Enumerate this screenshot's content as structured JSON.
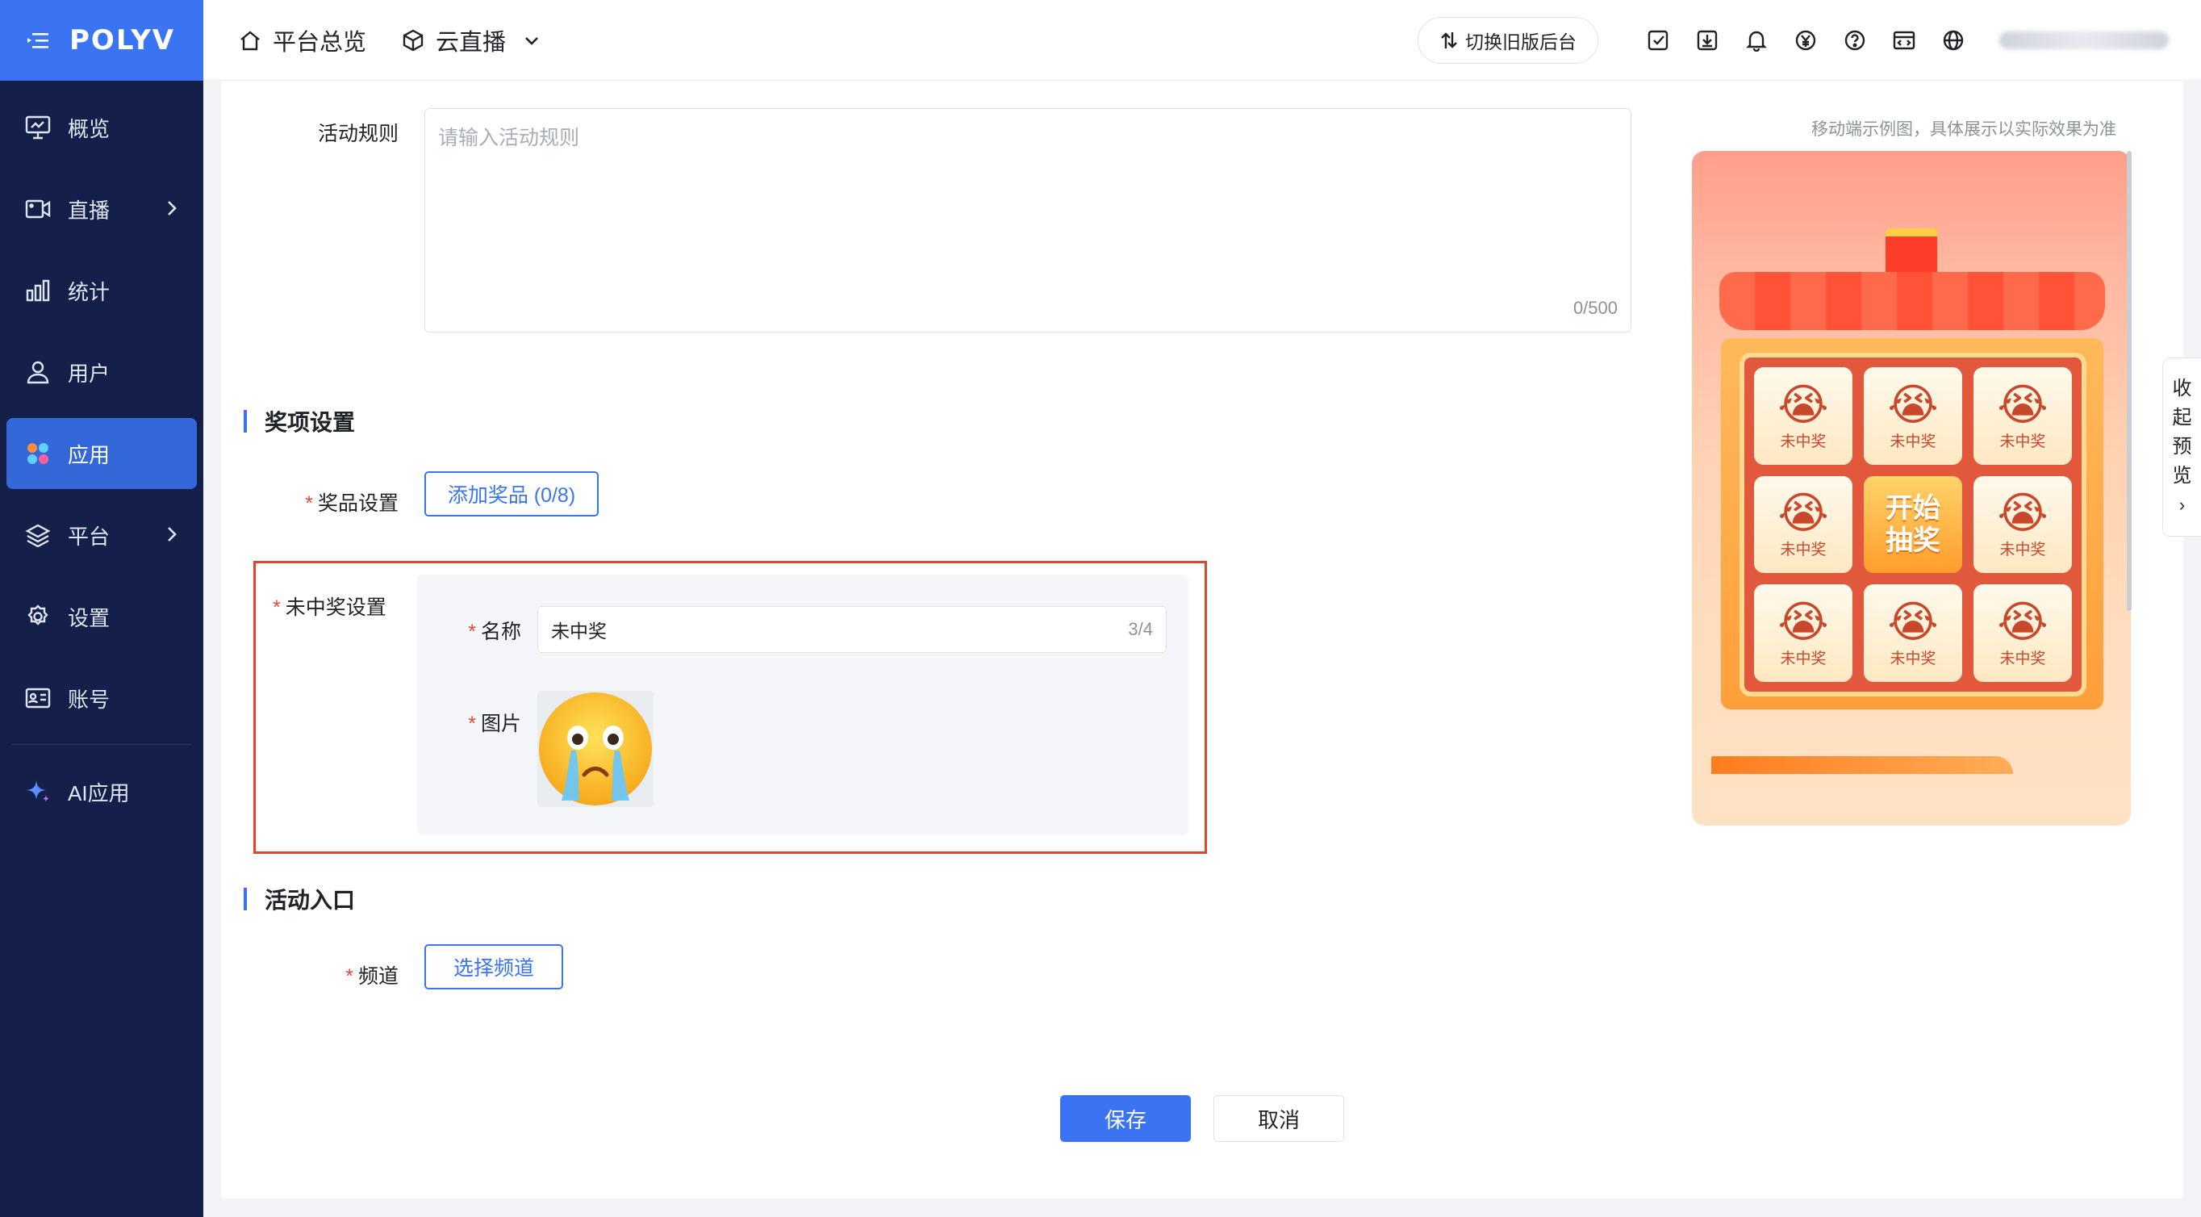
{
  "brand": {
    "logo": "POLYV"
  },
  "sidebar": {
    "items": [
      {
        "label": "概览",
        "icon": "monitor-icon"
      },
      {
        "label": "直播",
        "icon": "video-icon"
      },
      {
        "label": "统计",
        "icon": "bar-chart-icon"
      },
      {
        "label": "用户",
        "icon": "user-icon"
      },
      {
        "label": "应用",
        "icon": "apps-icon"
      },
      {
        "label": "平台",
        "icon": "layers-icon"
      },
      {
        "label": "设置",
        "icon": "gear-icon"
      },
      {
        "label": "账号",
        "icon": "id-card-icon"
      },
      {
        "label": "AI应用",
        "icon": "sparkle-icon"
      }
    ],
    "active": "应用"
  },
  "topbar": {
    "overview": "平台总览",
    "product": "云直播",
    "switch_old": "切换旧版后台"
  },
  "form": {
    "rules_label": "活动规则",
    "rules_placeholder": "请输入活动规则",
    "rules_counter": "0/500",
    "prize_section": "奖项设置",
    "prize_label": "奖品设置",
    "add_prize": "添加奖品 (0/8)",
    "no_prize_label": "未中奖设置",
    "name_label": "名称",
    "name_value": "未中奖",
    "name_counter": "3/4",
    "image_label": "图片",
    "entry_section": "活动入口",
    "channel_label": "频道",
    "select_channel": "选择频道",
    "save": "保存",
    "cancel": "取消"
  },
  "preview": {
    "note": "移动端示例图，具体展示以实际效果为准",
    "cell_label": "未中奖",
    "center_line1": "开始",
    "center_line2": "抽奖",
    "collapse_chars": [
      "收",
      "起",
      "预",
      "览"
    ],
    "collapse_arrow": "›"
  },
  "colors": {
    "brand": "#3b74f2",
    "sidebar": "#14204a",
    "highlight": "#e2452e"
  }
}
